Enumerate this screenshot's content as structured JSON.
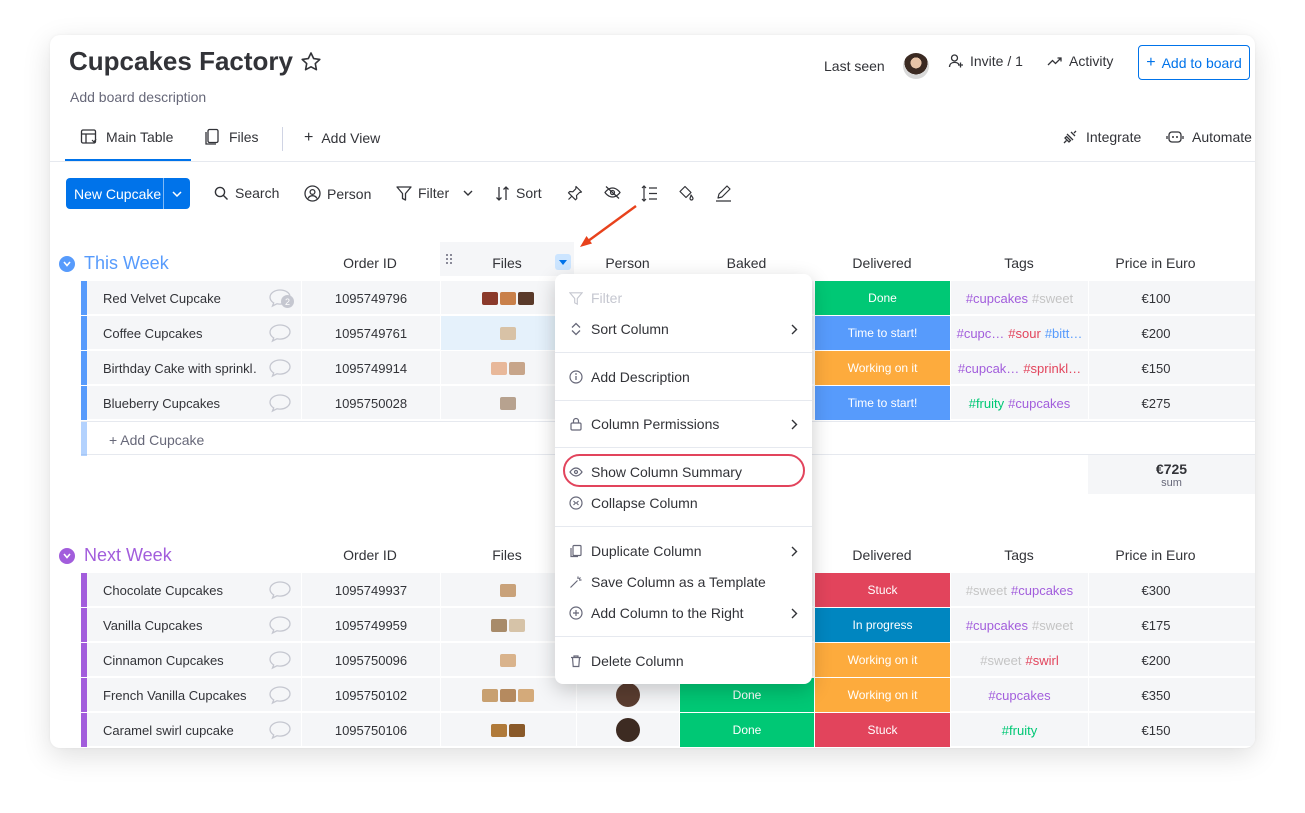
{
  "board": {
    "title": "Cupcakes Factory",
    "description": "Add board description"
  },
  "header": {
    "last_seen": "Last seen",
    "invite": "Invite / 1",
    "activity": "Activity",
    "add_to_board": "Add to board"
  },
  "tabs": {
    "main_table": "Main Table",
    "files": "Files",
    "add_view": "Add View",
    "integrate": "Integrate",
    "automate": "Automate"
  },
  "toolbar": {
    "new_item": "New Cupcake",
    "search": "Search",
    "person": "Person",
    "filter": "Filter",
    "sort": "Sort"
  },
  "columns": {
    "order_id": "Order ID",
    "files": "Files",
    "person": "Person",
    "baked": "Baked",
    "delivered": "Delivered",
    "tags": "Tags",
    "price": "Price in Euro"
  },
  "groups": [
    {
      "title": "This Week",
      "color": "#579bfc",
      "add_item": "+ Add Cupcake",
      "summary": {
        "value": "€725",
        "label": "sum"
      },
      "rows": [
        {
          "name": "Red Velvet Cupcake",
          "comments": "2",
          "order_id": "1095749796",
          "delivered": "Done",
          "delivered_color": "#00c875",
          "tags": [
            {
              "t": "#cupcakes",
              "c": "#a25ddc"
            },
            {
              "t": "#sweet",
              "c": "#c4c4c4"
            }
          ],
          "price": "€100"
        },
        {
          "name": "Coffee Cupcakes",
          "comments": "",
          "order_id": "1095749761",
          "delivered": "Time to start!",
          "delivered_color": "#579bfc",
          "tags": [
            {
              "t": "#cupc…",
              "c": "#a25ddc"
            },
            {
              "t": "#sour",
              "c": "#e2445c"
            },
            {
              "t": "#bitt…",
              "c": "#579bfc"
            }
          ],
          "price": "€200"
        },
        {
          "name": "Birthday Cake with sprinkl…",
          "comments": "",
          "order_id": "1095749914",
          "delivered": "Working on it",
          "delivered_color": "#fdab3d",
          "tags": [
            {
              "t": "#cupcak…",
              "c": "#a25ddc"
            },
            {
              "t": "#sprinkl…",
              "c": "#e2445c"
            }
          ],
          "price": "€150"
        },
        {
          "name": "Blueberry Cupcakes",
          "comments": "",
          "order_id": "1095750028",
          "delivered": "Time to start!",
          "delivered_color": "#579bfc",
          "tags": [
            {
              "t": "#fruity",
              "c": "#00c875"
            },
            {
              "t": "#cupcakes",
              "c": "#a25ddc"
            }
          ],
          "price": "€275"
        }
      ]
    },
    {
      "title": "Next Week",
      "color": "#a25ddc",
      "rows": [
        {
          "name": "Chocolate Cupcakes",
          "order_id": "1095749937",
          "baked": "",
          "delivered": "Stuck",
          "delivered_color": "#e2445c",
          "tags": [
            {
              "t": "#sweet",
              "c": "#c4c4c4"
            },
            {
              "t": "#cupcakes",
              "c": "#a25ddc"
            }
          ],
          "price": "€300"
        },
        {
          "name": "Vanilla Cupcakes",
          "order_id": "1095749959",
          "baked": "",
          "delivered": "In progress",
          "delivered_color": "#0086c0",
          "tags": [
            {
              "t": "#cupcakes",
              "c": "#a25ddc"
            },
            {
              "t": "#sweet",
              "c": "#c4c4c4"
            }
          ],
          "price": "€175"
        },
        {
          "name": "Cinnamon Cupcakes",
          "order_id": "1095750096",
          "baked": "",
          "delivered": "Working on it",
          "delivered_color": "#fdab3d",
          "tags": [
            {
              "t": "#sweet",
              "c": "#c4c4c4"
            },
            {
              "t": "#swirl",
              "c": "#e2445c"
            }
          ],
          "price": "€200"
        },
        {
          "name": "French Vanilla Cupcakes",
          "order_id": "1095750102",
          "baked": "Done",
          "delivered": "Working on it",
          "delivered_color": "#fdab3d",
          "tags": [
            {
              "t": "#cupcakes",
              "c": "#a25ddc"
            }
          ],
          "price": "€350"
        },
        {
          "name": "Caramel swirl cupcake",
          "order_id": "1095750106",
          "baked": "Done",
          "delivered": "Stuck",
          "delivered_color": "#e2445c",
          "tags": [
            {
              "t": "#fruity",
              "c": "#00c875"
            }
          ],
          "price": "€150"
        }
      ]
    }
  ],
  "menu": {
    "filter": "Filter",
    "sort_column": "Sort Column",
    "add_description": "Add Description",
    "column_permissions": "Column Permissions",
    "show_column_summary": "Show Column Summary",
    "collapse_column": "Collapse Column",
    "duplicate_column": "Duplicate Column",
    "save_template": "Save Column as a Template",
    "add_column_right": "Add Column to the Right",
    "delete_column": "Delete Column"
  },
  "colors": {
    "accent": "#0073ea",
    "highlight": "#e2445c",
    "arrow": "#e8421c"
  }
}
